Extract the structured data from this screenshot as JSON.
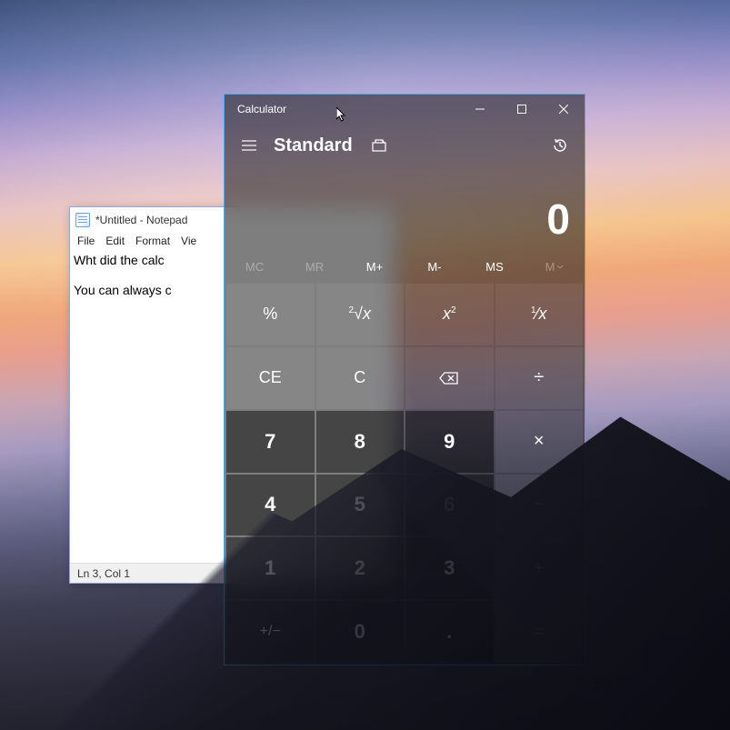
{
  "notepad": {
    "title": "*Untitled - Notepad",
    "menu": [
      "File",
      "Edit",
      "Format",
      "Vie"
    ],
    "line1": "Wht did the calc",
    "line3": "You can always c",
    "status": "Ln 3, Col 1"
  },
  "calculator": {
    "title": "Calculator",
    "mode": "Standard",
    "display": "0",
    "memory": {
      "mc": "MC",
      "mr": "MR",
      "mplus": "M+",
      "mminus": "M-",
      "ms": "MS",
      "mlist": "M"
    },
    "keys": {
      "percent": "%",
      "root": "²√x",
      "square": "x²",
      "recip": "¹⁄ₓ",
      "ce": "CE",
      "c": "C",
      "back": "⌫",
      "div": "÷",
      "7": "7",
      "8": "8",
      "9": "9",
      "mul": "×",
      "4": "4",
      "5": "5",
      "6": "6",
      "minus": "−",
      "1": "1",
      "2": "2",
      "3": "3",
      "plus": "+",
      "neg": "⁺⁄₋",
      "0": "0",
      "dot": ".",
      "eq": "="
    }
  }
}
